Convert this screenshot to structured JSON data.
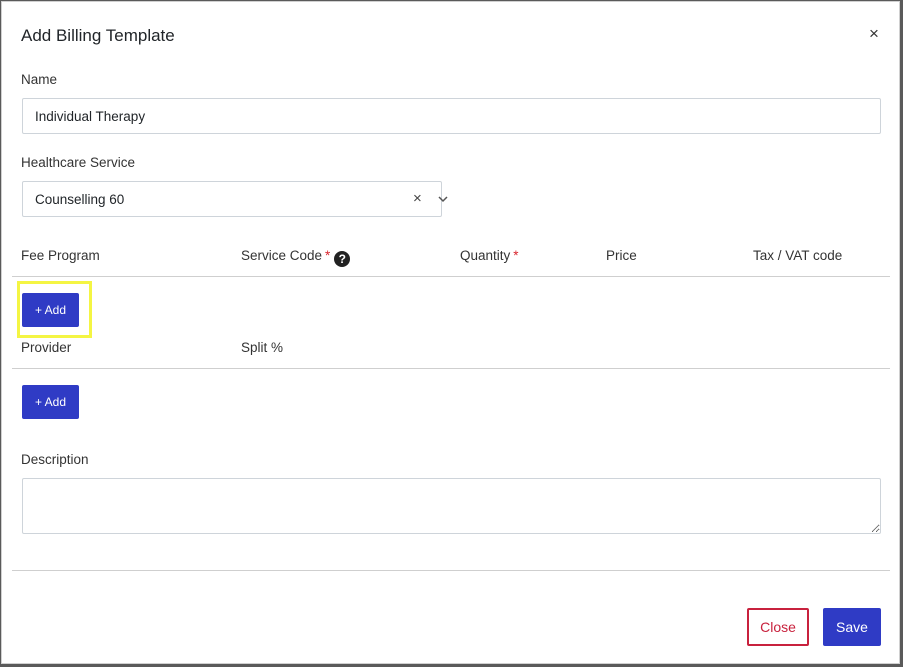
{
  "modal": {
    "title": "Add Billing Template",
    "close_icon": "close-icon"
  },
  "name": {
    "label": "Name",
    "value": "Individual Therapy"
  },
  "healthcare_service": {
    "label": "Healthcare Service",
    "value": "Counselling 60",
    "clear_glyph": "×"
  },
  "fee_table": {
    "columns": [
      "Fee Program",
      "Service Code",
      "Quantity",
      "Price",
      "Tax / VAT code"
    ],
    "required_marker": "*",
    "help_glyph": "?",
    "add_label": "+ Add"
  },
  "provider_table": {
    "columns": [
      "Provider",
      "Split %"
    ],
    "add_label": "+ Add"
  },
  "description": {
    "label": "Description",
    "value": ""
  },
  "footer": {
    "close_label": "Close",
    "save_label": "Save"
  },
  "colors": {
    "primary": "#2f3bc5",
    "danger": "#c8213d",
    "highlight": "#f4f543"
  }
}
